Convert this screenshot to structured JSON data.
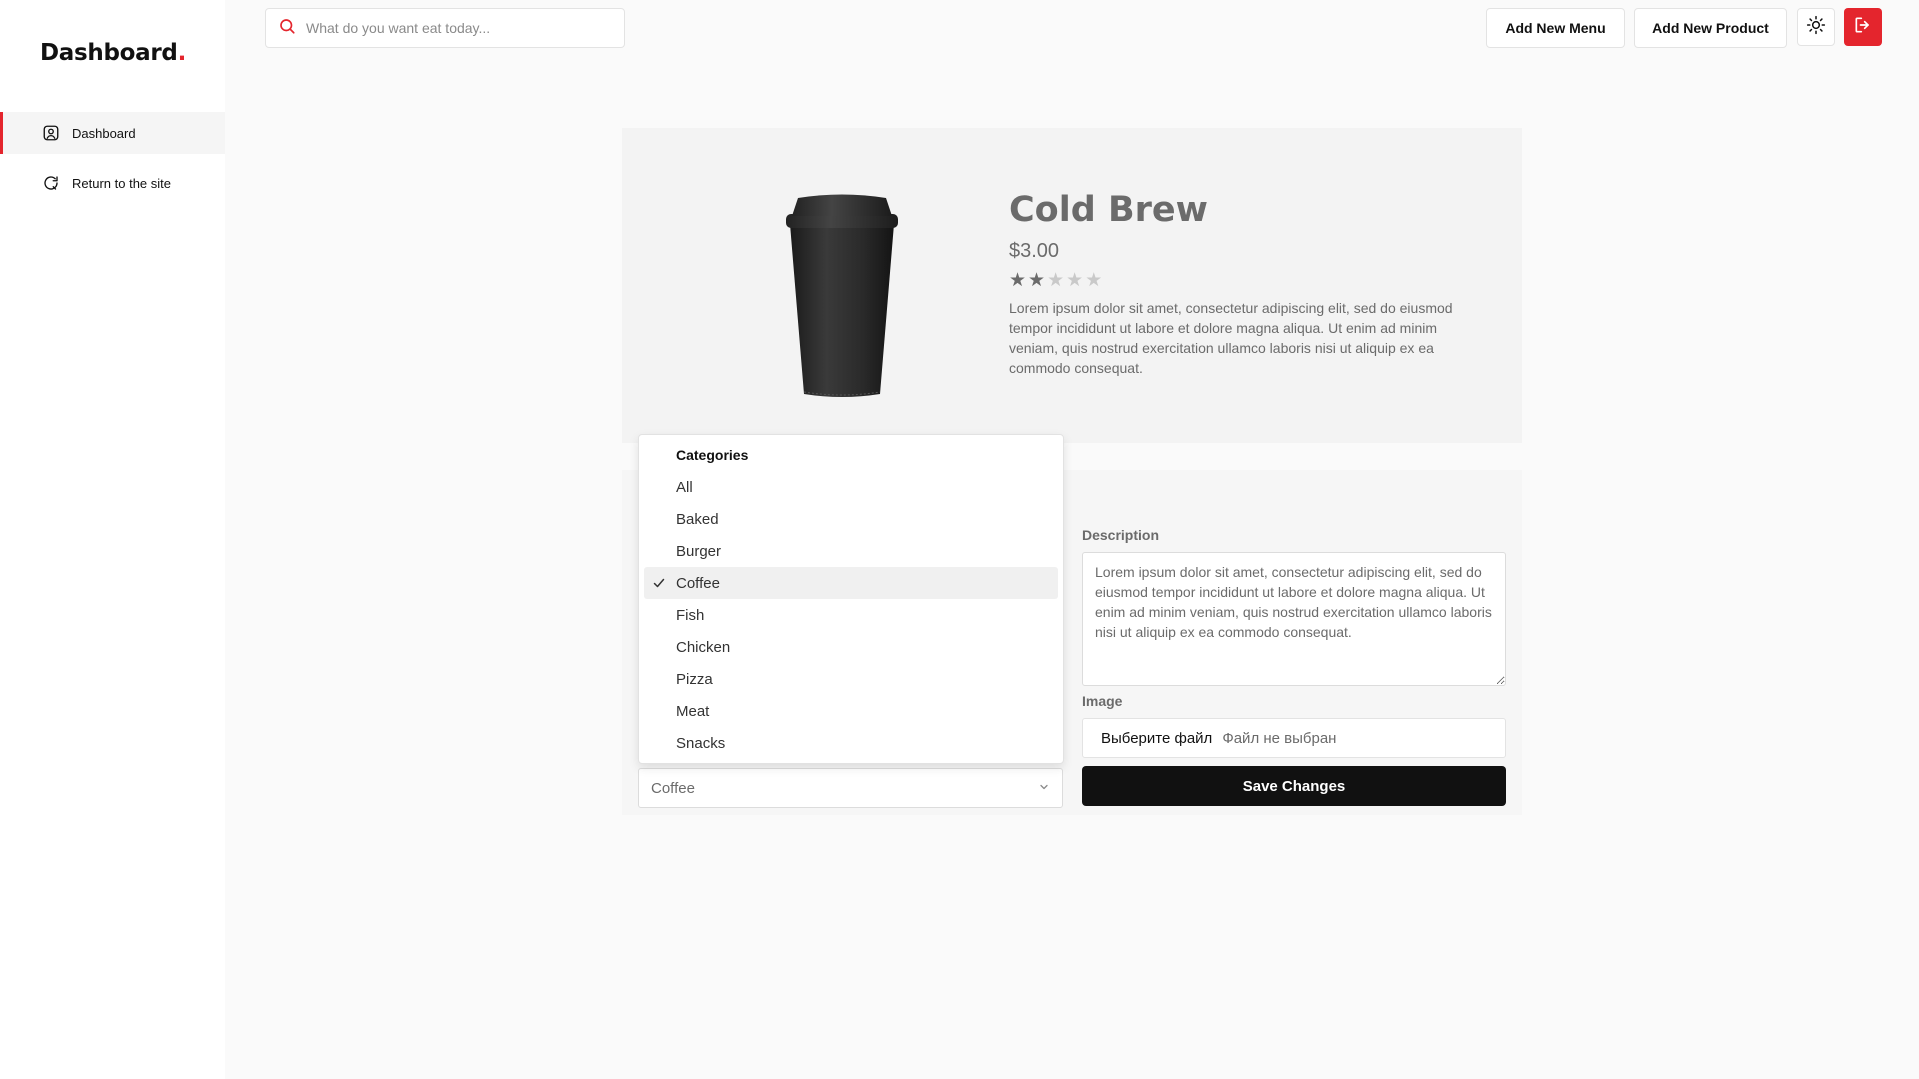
{
  "brand": {
    "name": "Dashboard",
    "dot": "."
  },
  "sidebar": {
    "items": [
      {
        "label": "Dashboard",
        "icon": "user-icon",
        "active": true
      },
      {
        "label": "Return to the site",
        "icon": "refresh-icon",
        "active": false
      }
    ]
  },
  "search": {
    "placeholder": "What do you want eat today..."
  },
  "topbar": {
    "add_menu_label": "Add New Menu",
    "add_product_label": "Add New Product",
    "theme_icon": "sun-icon",
    "logout_icon": "logout-icon"
  },
  "product": {
    "title": "Cold Brew",
    "price": "$3.00",
    "rating": 2,
    "rating_max": 5,
    "description": "Lorem ipsum dolor sit amet, consectetur adipiscing elit, sed do eiusmod tempor incididunt ut labore et dolore magna aliqua. Ut enim ad minim veniam, quis nostrud exercitation ullamco laboris nisi ut aliquip ex ea commodo consequat.",
    "image": "coffee-cup"
  },
  "form": {
    "description_label": "Description",
    "description_value": "Lorem ipsum dolor sit amet, consectetur adipiscing elit, sed do eiusmod tempor incididunt ut labore et dolore magna aliqua. Ut enim ad minim veniam, quis nostrud exercitation ullamco laboris nisi ut aliquip ex ea commodo consequat.",
    "image_label": "Image",
    "file_choose_label": "Выберите файл",
    "file_none_label": "Файл не выбран",
    "save_label": "Save Changes"
  },
  "category_select": {
    "selected": "Coffee",
    "header": "Categories",
    "options": [
      "All",
      "Baked",
      "Burger",
      "Coffee",
      "Fish",
      "Chicken",
      "Pizza",
      "Meat",
      "Snacks"
    ]
  },
  "colors": {
    "accent": "#e4252d",
    "dark": "#111111",
    "muted": "#6b6b6b",
    "star_on": "#6b6b6b",
    "star_off": "#c9c9c9"
  }
}
